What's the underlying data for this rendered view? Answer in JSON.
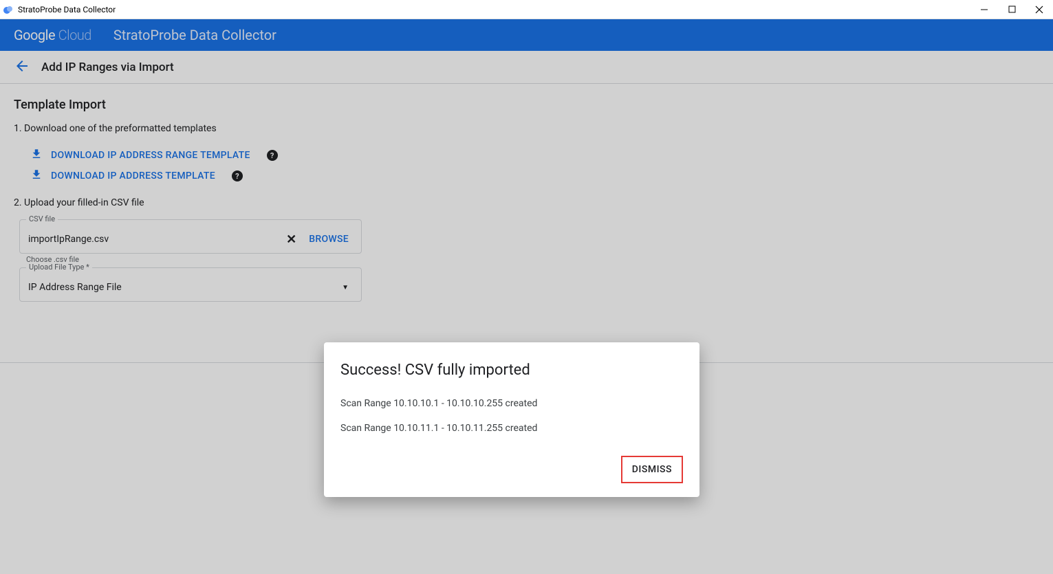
{
  "window": {
    "title": "StratoProbe Data Collector"
  },
  "header": {
    "brand_a": "Google",
    "brand_b": "Cloud",
    "app_title": "StratoProbe Data Collector"
  },
  "subheader": {
    "title": "Add IP Ranges via Import"
  },
  "section": {
    "title": "Template Import",
    "step1": "1. Download one of the preformatted templates",
    "download_range": "DOWNLOAD IP ADDRESS RANGE TEMPLATE",
    "download_address": "DOWNLOAD IP ADDRESS TEMPLATE",
    "step2": "2. Upload your filled-in CSV file"
  },
  "csv_input": {
    "label": "CSV file",
    "value": "importIpRange.csv",
    "browse": "BROWSE"
  },
  "type_input": {
    "hint": "Choose .csv file",
    "label": "Upload File Type *",
    "value": "IP Address Range File"
  },
  "modal": {
    "title": "Success! CSV fully imported",
    "line1": "Scan Range 10.10.10.1 - 10.10.10.255 created",
    "line2": "Scan Range 10.10.11.1 - 10.10.11.255 created",
    "dismiss": "DISMISS"
  }
}
